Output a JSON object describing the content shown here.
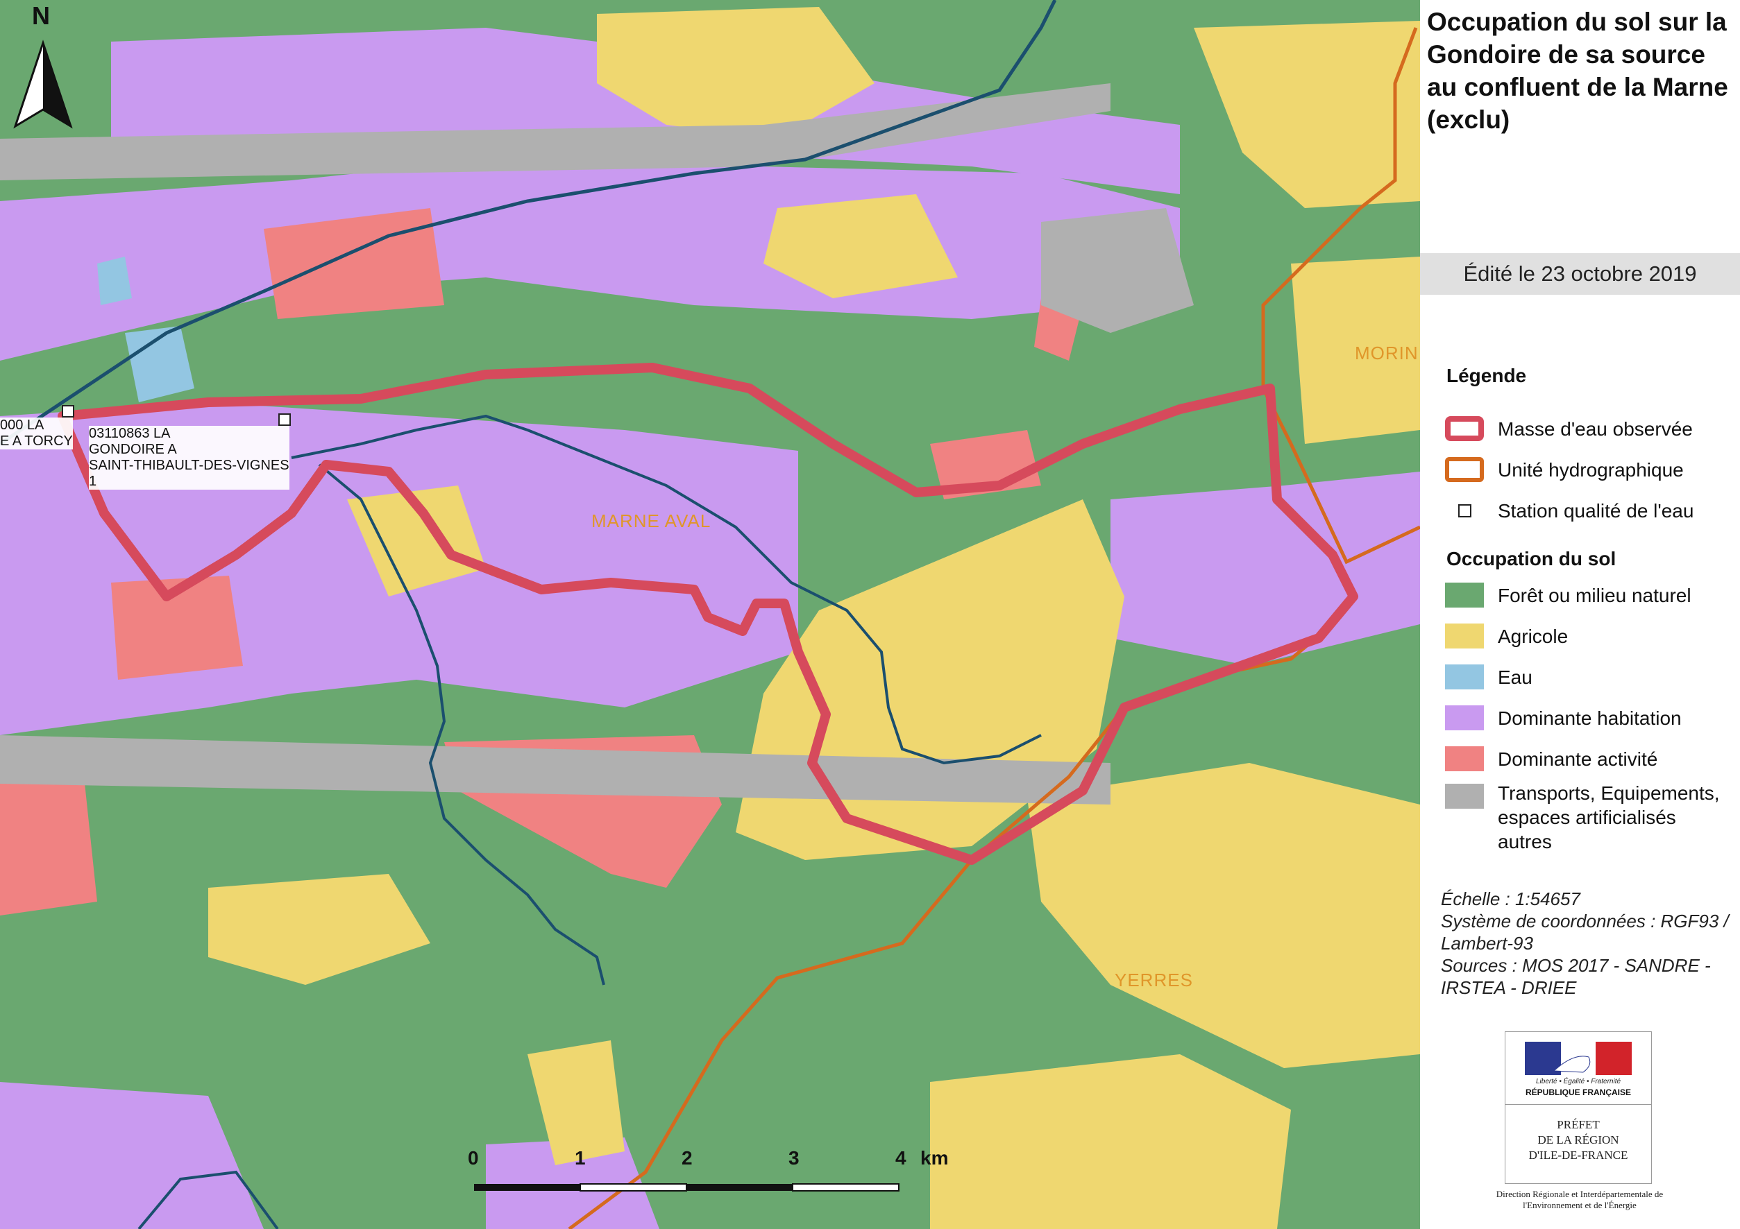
{
  "title": "Occupation du sol sur la Gondoire de sa source au confluent de la Marne (exclu)",
  "edited": "Édité le 23 octobre 2019",
  "north_label": "N",
  "legend": {
    "heading": "Légende",
    "lines": [
      {
        "label": "Masse d'eau observée",
        "color": "#d64a5c"
      },
      {
        "label": "Unité hydrographique",
        "color": "#d56a1e"
      },
      {
        "label": "Station qualité de l'eau",
        "color": "#ffffff"
      }
    ],
    "landuse_heading": "Occupation du sol",
    "landuse": [
      {
        "label": "Forêt ou milieu naturel",
        "color": "#6aa870"
      },
      {
        "label": "Agricole",
        "color": "#efd770"
      },
      {
        "label": "Eau",
        "color": "#93c6e2"
      },
      {
        "label": "Dominante habitation",
        "color": "#c99af0"
      },
      {
        "label": "Dominante activité",
        "color": "#f08282"
      },
      {
        "label": "Transports, Equipements, espaces artificialisés autres",
        "color": "#b0b0b0"
      }
    ]
  },
  "meta": {
    "scale": "Échelle : 1:54657",
    "crs": "Système de coordonnées : RGF93 / Lambert-93",
    "sources": "Sources : MOS 2017 - SANDRE - IRSTEA - DRIEE"
  },
  "logo": {
    "motto": "Liberté • Égalité • Fraternité",
    "republic": "RÉPUBLIQUE FRANÇAISE",
    "prefet": "PRÉFET",
    "region1": "DE LA RÉGION",
    "region2": "D'ILE-DE-FRANCE",
    "dreal": "Direction Régionale et Interdépartementale de l'Environnement et de l'Énergie"
  },
  "stations": [
    {
      "label": "000 LA\nE A TORCY"
    },
    {
      "label": "03110863 LA\nGONDOIRE A\nSAINT-THIBAULT-DES-VIGNES\n1"
    }
  ],
  "places": [
    "MARNE AVAL",
    "YERRES",
    "MORIN"
  ],
  "scalebar": {
    "ticks": [
      "0",
      "1",
      "2",
      "3",
      "4"
    ],
    "unit": "km"
  }
}
